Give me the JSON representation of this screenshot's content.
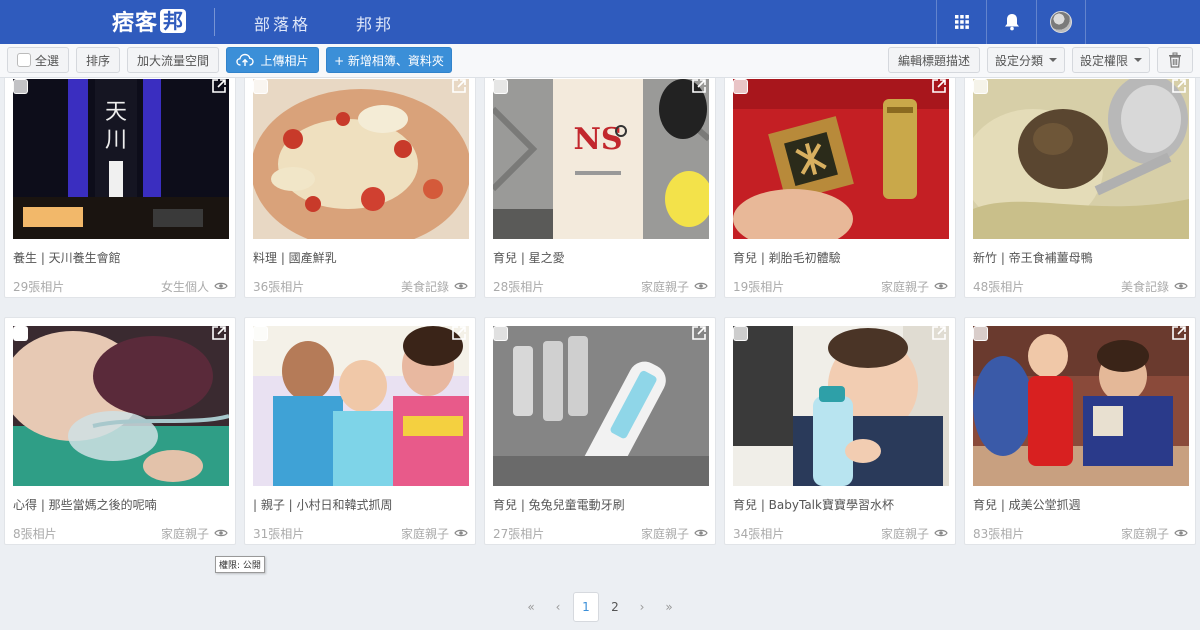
{
  "header": {
    "logo_text": "痞客",
    "logo_badge": "邦",
    "nav": [
      "部落格",
      "邦邦"
    ]
  },
  "toolbar": {
    "select_all": "全選",
    "sort": "排序",
    "expand_space": "加大流量空間",
    "upload": "上傳相片",
    "new_album": "+ 新增相簿、資料夾",
    "edit_desc": "編輯標題描述",
    "set_category": "設定分類",
    "set_permission": "設定權限"
  },
  "albums": [
    {
      "title": "養生 | 天川養生會館",
      "count": "29張相片",
      "category": "女生個人"
    },
    {
      "title": "料理 | 國產鮮乳",
      "count": "36張相片",
      "category": "美食記錄"
    },
    {
      "title": "育兒 | 星之愛",
      "count": "28張相片",
      "category": "家庭親子"
    },
    {
      "title": "育兒 | 剃胎毛初體驗",
      "count": "19張相片",
      "category": "家庭親子"
    },
    {
      "title": "新竹 | 帝王食補薑母鴨",
      "count": "48張相片",
      "category": "美食記錄"
    },
    {
      "title": "心得 | 那些當媽之後的呢喃",
      "count": "8張相片",
      "category": "家庭親子"
    },
    {
      "title": "| 親子 | 小村日和韓式抓周",
      "count": "31張相片",
      "category": "家庭親子"
    },
    {
      "title": "育兒 | 兔兔兒童電動牙刷",
      "count": "27張相片",
      "category": "家庭親子"
    },
    {
      "title": "育兒 | BabyTalk寶寶學習水杯",
      "count": "34張相片",
      "category": "家庭親子"
    },
    {
      "title": "育兒 | 成美公堂抓週",
      "count": "83張相片",
      "category": "家庭親子"
    }
  ],
  "tooltip": "權限: 公開",
  "pagination": {
    "first": "«",
    "prev": "‹",
    "current": "1",
    "next_page": "2",
    "next": "›",
    "last": "»"
  },
  "colors": {
    "brand": "#2f5bbd",
    "primary_button": "#3b8fd8"
  },
  "icons": [
    "apps-grid-icon",
    "bell-icon",
    "avatar",
    "trash-icon",
    "upload-cloud-icon",
    "external-link-icon",
    "eye-icon"
  ]
}
